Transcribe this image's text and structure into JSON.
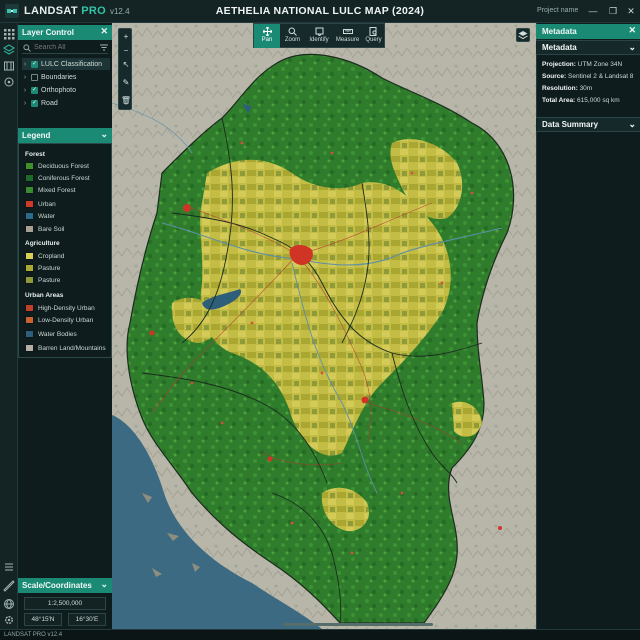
{
  "app": {
    "brand": "LANDSAT",
    "brand_accent": "PRO",
    "version": "v12.4",
    "title": "AETHELIA NATIONAL LULC MAP (2024)",
    "project_placeholder": "Project name",
    "status_text": "LANDSAT PRO v12.4"
  },
  "layer_control": {
    "title": "Layer Control",
    "search_placeholder": "Search All",
    "layers": [
      {
        "label": "LULC Classification",
        "checked": true
      },
      {
        "label": "Boundaries",
        "checked": false
      },
      {
        "label": "Orthophoto",
        "checked": true
      },
      {
        "label": "Road",
        "checked": true
      }
    ]
  },
  "legend": {
    "title": "Legend",
    "groups": [
      {
        "name": "Forest",
        "items": [
          {
            "label": "Deciduous Forest",
            "color": "#3f8f2a"
          },
          {
            "label": "Coniferous Forest",
            "color": "#1c6b2a"
          },
          {
            "label": "Mixed Forest",
            "color": "#3a8a32"
          },
          {
            "label": "Urban",
            "color": "#d03a2a"
          },
          {
            "label": "Water",
            "color": "#2b6a8a"
          },
          {
            "label": "Bare Soil",
            "color": "#a8a094"
          }
        ]
      },
      {
        "name": "Agriculture",
        "items": [
          {
            "label": "Cropland",
            "color": "#d8cf5a"
          },
          {
            "label": "Pasture",
            "color": "#a9a832"
          },
          {
            "label": "Pasture",
            "color": "#8e9a3a"
          }
        ]
      },
      {
        "name": "Urban Areas",
        "items": [
          {
            "label": "High-Density Urban",
            "color": "#c0402e"
          },
          {
            "label": "Low-Density Urban",
            "color": "#c8652e"
          },
          {
            "label": "Water Bodies",
            "color": "#2d5e7a"
          },
          {
            "label": "Barren Land/Mountains",
            "color": "#b4b0a6"
          }
        ]
      }
    ]
  },
  "scale_panel": {
    "title": "Scale/Coordinates",
    "scale": "1:2,500,000",
    "lat": "48°15'N",
    "lon": "16°30'E"
  },
  "tools": [
    {
      "label": "Pan",
      "icon": "pan-icon",
      "active": true
    },
    {
      "label": "Zoom",
      "icon": "zoom-icon",
      "active": false
    },
    {
      "label": "Identify",
      "icon": "identify-icon",
      "active": false
    },
    {
      "label": "Measure",
      "icon": "measure-icon",
      "active": false
    },
    {
      "label": "Query",
      "icon": "query-icon",
      "active": false
    }
  ],
  "metadata": {
    "panel_title": "Metadata",
    "section_title": "Metadata",
    "rows": [
      {
        "key": "Projection:",
        "value": "UTM Zone 34N"
      },
      {
        "key": "Source:",
        "value": "Sentinel 2 & Landsat 8"
      },
      {
        "key": "Resolution:",
        "value": "30m"
      },
      {
        "key": "Total Area:",
        "value": "615,000 sq km"
      }
    ],
    "data_summary_title": "Data Summary"
  },
  "colors": {
    "accent": "#1a8a75",
    "panel_bg": "#0f1c1d",
    "forest": "#2f7d2c",
    "cropland": "#c9c24c",
    "urban": "#d03a2a",
    "water": "#2d5e7a",
    "sea": "#3c6a82",
    "terrain": "#b7b6a8"
  }
}
